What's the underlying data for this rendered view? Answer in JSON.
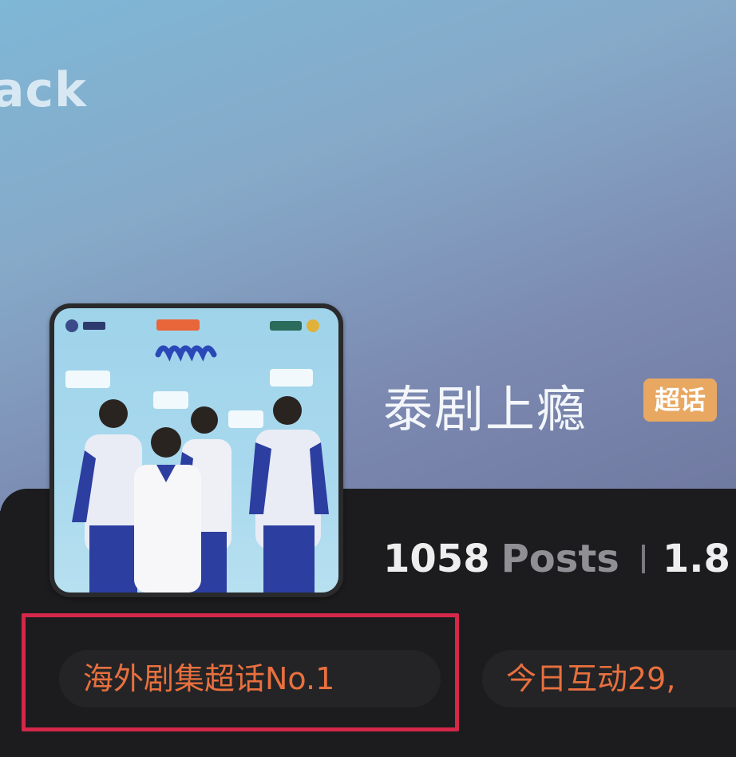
{
  "header": {
    "back_label": "ack"
  },
  "topic": {
    "title": "泰剧上瘾",
    "badge": "超话",
    "cover_icon": "drama-poster-icon"
  },
  "stats": {
    "posts_count": "1058",
    "posts_label": "Posts",
    "second_count": "1.8"
  },
  "tags": [
    {
      "label": "海外剧集超话No.1"
    },
    {
      "label": "今日互动29,"
    }
  ],
  "colors": {
    "badge_bg": "#e8a862",
    "tag_text": "#e8703e",
    "highlight_border": "#d4284a"
  }
}
